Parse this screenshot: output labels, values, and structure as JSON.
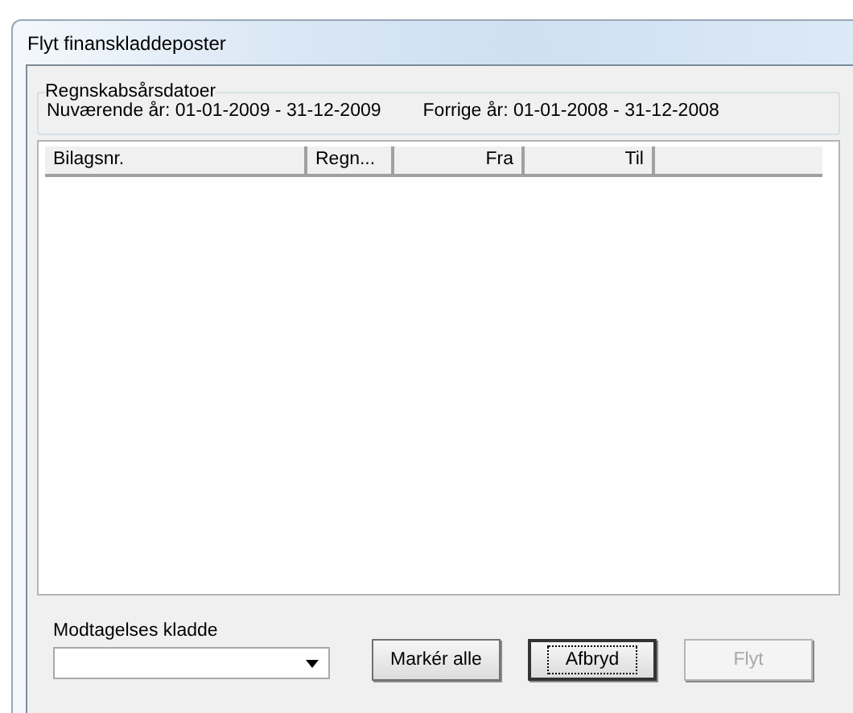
{
  "window": {
    "title": "Flyt finanskladdeposter"
  },
  "fiscal_dates": {
    "legend": "Regnskabsårsdatoer",
    "current": "Nuværende år: 01-01-2009 - 31-12-2009",
    "previous": "Forrige år: 01-01-2008 - 31-12-2008"
  },
  "table": {
    "columns": [
      "Bilagsnr.",
      "Regn...",
      "Fra",
      "Til"
    ]
  },
  "target_journal": {
    "label": "Modtagelses kladde"
  },
  "buttons": [
    {
      "label": "Markér alle",
      "focused": false,
      "disabled": false
    },
    {
      "label": "Afbryd",
      "focused": true,
      "disabled": false
    },
    {
      "label": "Flyt",
      "focused": false,
      "disabled": true
    }
  ]
}
